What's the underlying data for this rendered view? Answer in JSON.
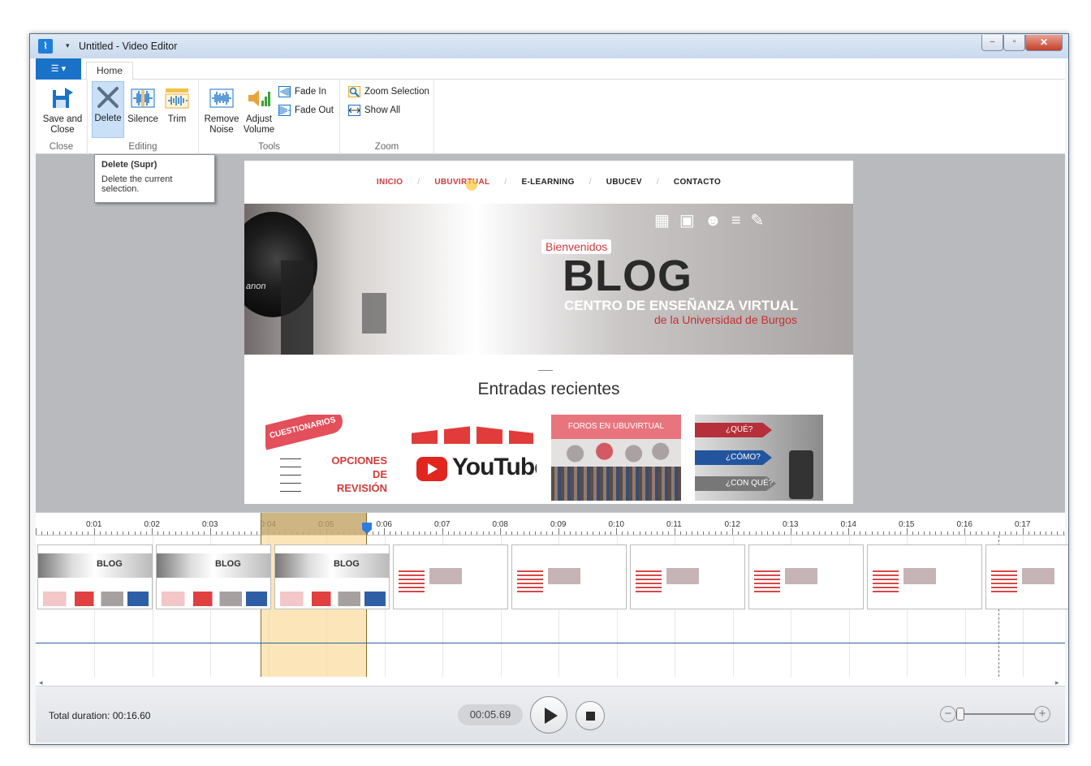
{
  "window": {
    "app_icon": "waveform-icon",
    "title": "Untitled - Video Editor",
    "controls": {
      "minimize": "‒",
      "maximize": "▫",
      "close": "✕"
    }
  },
  "ribbon": {
    "file_tab_icon": "menu-icon",
    "tabs": [
      "Home"
    ],
    "groups": {
      "close": {
        "label": "Close",
        "save_and_close": "Save and\nClose"
      },
      "editing": {
        "label": "Editing",
        "delete": "Delete",
        "silence": "Silence",
        "trim": "Trim"
      },
      "tools": {
        "label": "Tools",
        "remove_noise": "Remove\nNoise",
        "adjust_volume": "Adjust\nVolume",
        "fade_in": "Fade In",
        "fade_out": "Fade Out"
      },
      "zoom": {
        "label": "Zoom",
        "zoom_selection": "Zoom Selection",
        "show_all": "Show All"
      }
    }
  },
  "tooltip": {
    "title": "Delete (Supr)",
    "body": "Delete the current selection."
  },
  "preview": {
    "nav": [
      "INICIO",
      "UBUVIRTUAL",
      "E-LEARNING",
      "UBUCEV",
      "CONTACTO"
    ],
    "hero": {
      "welcome": "Bienvenidos",
      "title": "BLOG",
      "subtitle": "CENTRO DE ENSEÑANZA VIRTUAL",
      "university": "de la Universidad de Burgos",
      "camera_brand": "anon"
    },
    "recent_title": "Entradas recientes",
    "posts": [
      {
        "banner": "CUESTIONARIOS",
        "lines": [
          "OPCIONES",
          "DE",
          "REVISIÓN"
        ]
      },
      {
        "label": "YouTube"
      },
      {
        "label": "FOROS EN UBUVIRTUAL"
      },
      {
        "lines": [
          "¿QUÉ?",
          "¿CÓMO?",
          "¿CON QUÉ?"
        ]
      }
    ]
  },
  "timeline": {
    "ticks": [
      "0:01",
      "0:02",
      "0:03",
      "0:04",
      "0:05",
      "0:06",
      "0:07",
      "0:08",
      "0:09",
      "0:10",
      "0:11",
      "0:12",
      "0:13",
      "0:14",
      "0:15",
      "0:16",
      "0:17"
    ],
    "selection_start": "0:04",
    "selection_end": "0:05.69",
    "thumbnail_label": "BLOG",
    "thumbnail_count": 9
  },
  "transport": {
    "total_duration": "Total duration: 00:16.60",
    "current_time": "00:05.69",
    "zoom_out": "−",
    "zoom_in": "+"
  }
}
